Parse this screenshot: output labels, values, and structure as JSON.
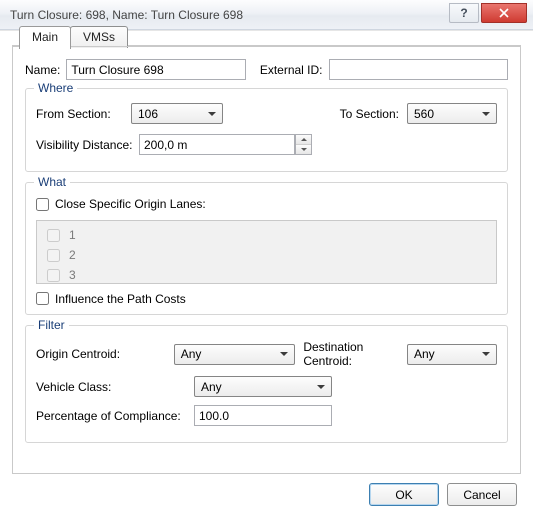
{
  "window": {
    "title": "Turn Closure: 698, Name: Turn Closure 698",
    "help_symbol": "?",
    "close_symbol": "X"
  },
  "tabs": {
    "main": "Main",
    "vmss": "VMSs"
  },
  "nameRow": {
    "nameLabel": "Name:",
    "nameValue": "Turn Closure 698",
    "externalIdLabel": "External ID:",
    "externalIdValue": ""
  },
  "where": {
    "legend": "Where",
    "fromSectionLabel": "From Section:",
    "fromSectionValue": "106",
    "toSectionLabel": "To Section:",
    "toSectionValue": "560",
    "visibilityLabel": "Visibility Distance:",
    "visibilityValue": "200,0 m"
  },
  "what": {
    "legend": "What",
    "closeLanesLabel": "Close Specific Origin Lanes:",
    "lanes": {
      "l1": "1",
      "l2": "2",
      "l3": "3"
    },
    "influenceLabel": "Influence the Path Costs"
  },
  "filter": {
    "legend": "Filter",
    "originCentroidLabel": "Origin Centroid:",
    "originCentroidValue": "Any",
    "destCentroidLabel": "Destination Centroid:",
    "destCentroidValue": "Any",
    "vehicleClassLabel": "Vehicle Class:",
    "vehicleClassValue": "Any",
    "percLabel": "Percentage of Compliance:",
    "percValue": "100.0"
  },
  "buttons": {
    "ok": "OK",
    "cancel": "Cancel"
  }
}
